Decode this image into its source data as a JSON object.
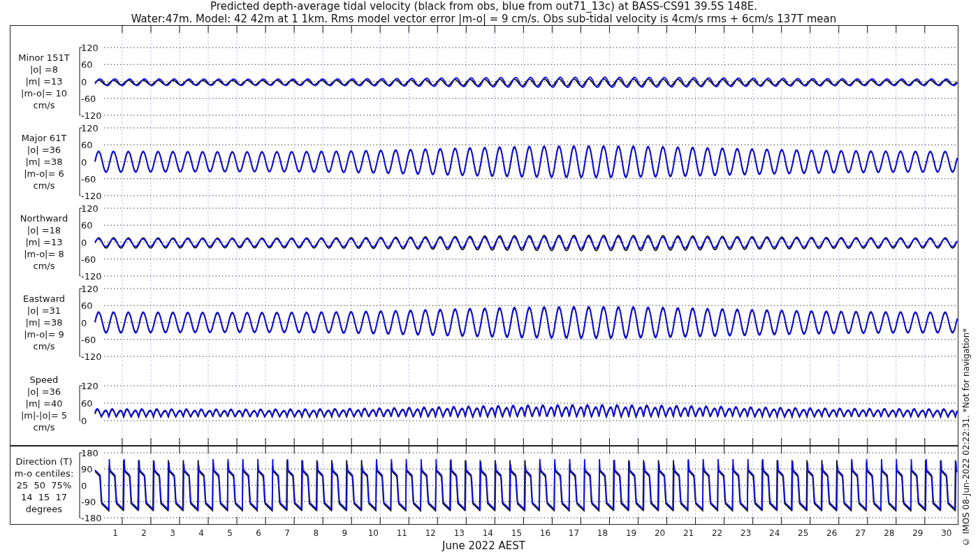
{
  "title": [
    "Predicted depth-average tidal velocity (black from obs, blue from out71_13c) at BASS-CS91 39.5S 148E.",
    "Water:47m. Model: 42 42m at 1 1km. Rms model vector error |m-o| = 9 cm/s. Obs sub-tidal velocity is 4cm/s rms + 6cm/s 137T mean"
  ],
  "panels": [
    {
      "kind": "velocity",
      "label_lines": [
        "Minor 151T",
        "|o| =8",
        "|m| =13",
        "|m-o|= 10",
        "cm/s"
      ],
      "yticks": [
        "120",
        "60",
        "0",
        "-60",
        "-120"
      ]
    },
    {
      "kind": "velocity",
      "label_lines": [
        "Major 61T",
        "|o| =36",
        "|m| =38",
        "|m-o|= 6",
        "cm/s"
      ],
      "yticks": [
        "120",
        "60",
        "0",
        "-60",
        "-120"
      ]
    },
    {
      "kind": "velocity",
      "label_lines": [
        "Northward",
        "|o| =18",
        "|m| =13",
        "|m-o|= 8",
        "cm/s"
      ],
      "yticks": [
        "120",
        "60",
        "0",
        "-60",
        "-120"
      ]
    },
    {
      "kind": "velocity",
      "label_lines": [
        "Eastward",
        "|o| =31",
        "|m| =38",
        "|m-o|= 9",
        "cm/s"
      ],
      "yticks": [
        "120",
        "60",
        "0",
        "-60",
        "-120"
      ]
    },
    {
      "kind": "speed",
      "label_lines": [
        "Speed",
        "|o| =36",
        "|m| =40",
        "|m|-|o|= 5",
        "cm/s"
      ],
      "yticks": [
        "120",
        "60",
        "0"
      ]
    },
    {
      "kind": "direction",
      "label_lines": [
        "Direction (T)",
        "m-o centiles:",
        "25  50  75%",
        "14  15  17",
        "degrees"
      ],
      "yticks": [
        "180",
        "90",
        "0",
        "-90",
        "-180"
      ]
    }
  ],
  "x_axis": {
    "day_labels": [
      "1",
      "2",
      "3",
      "4",
      "5",
      "6",
      "7",
      "8",
      "9",
      "10",
      "11",
      "12",
      "13",
      "14",
      "15",
      "16",
      "17",
      "18",
      "19",
      "20",
      "21",
      "22",
      "23",
      "24",
      "25",
      "26",
      "27",
      "28",
      "29",
      "30"
    ],
    "label": "June 2022 AEST"
  },
  "footer_note": "© IMOS 08-Jun-2022 02:22:31. *Not for navigation*"
}
